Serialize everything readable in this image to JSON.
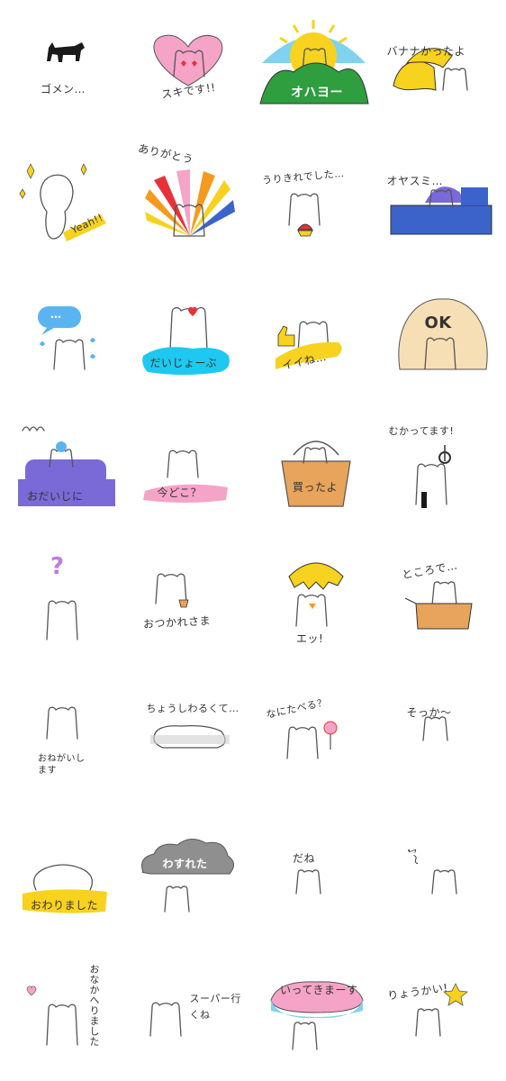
{
  "stickers": [
    {
      "label": "ゴメン…"
    },
    {
      "label": "スキです!!"
    },
    {
      "label": "オハヨー"
    },
    {
      "label": "バナナかったよ"
    },
    {
      "label": "Yeah!!"
    },
    {
      "label": "ありがとう"
    },
    {
      "label": "うりきれでした…"
    },
    {
      "label": "オヤスミ…"
    },
    {
      "label": "…"
    },
    {
      "label": "だいじょーぶ"
    },
    {
      "label": "イイね…"
    },
    {
      "label": "OK"
    },
    {
      "label": "おだいじに"
    },
    {
      "label": "今どこ？"
    },
    {
      "label": "買ったよ"
    },
    {
      "label": "むかってます!"
    },
    {
      "label": "?"
    },
    {
      "label": "おつかれさま"
    },
    {
      "label": "エッ!"
    },
    {
      "label": "ところで…"
    },
    {
      "label": "おねがいします"
    },
    {
      "label": "ちょうしわるくて…"
    },
    {
      "label": "なにたべる？"
    },
    {
      "label": "そっか～"
    },
    {
      "label": "おわりました"
    },
    {
      "label": "わすれた"
    },
    {
      "label": "だね"
    },
    {
      "label": "♪～"
    },
    {
      "label": "おなかへりました"
    },
    {
      "label": "スーパー行くね"
    },
    {
      "label": "いってきまーす"
    },
    {
      "label": "りょうかい!"
    }
  ],
  "colors": {
    "pink": "#f5a3c7",
    "green": "#2e9e3e",
    "yellow": "#f7d21e",
    "sky": "#7fd3ef",
    "blue": "#5ab4f0",
    "navy": "#3b63c9",
    "purple": "#7a6ad8",
    "cyan": "#1ec8f0",
    "tan": "#e7a45a",
    "violet": "#c07ce0",
    "gray": "#8f8f8f",
    "orange": "#f59a1e"
  }
}
